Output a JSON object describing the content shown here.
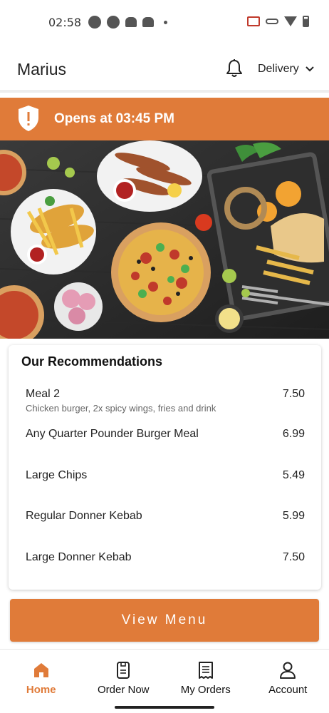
{
  "status_bar": {
    "time": "02:58"
  },
  "header": {
    "title": "Marius",
    "delivery_label": "Delivery"
  },
  "banner": {
    "text": "Opens at 03:45 PM",
    "icon_glyph": "!",
    "color": "#e07b39"
  },
  "recommendations": {
    "title": "Our Recommendations",
    "items": [
      {
        "name": "Meal 2",
        "description": "Chicken burger, 2x spicy wings, fries and drink",
        "price": "7.50"
      },
      {
        "name": "Any Quarter Pounder Burger Meal",
        "price": "6.99"
      },
      {
        "name": "Large Chips",
        "price": "5.49"
      },
      {
        "name": "Regular Donner Kebab",
        "price": "5.99"
      },
      {
        "name": "Large Donner Kebab",
        "price": "7.50"
      }
    ]
  },
  "view_menu_label": "View Menu",
  "bottom_nav": [
    {
      "label": "Home",
      "icon": "home-icon",
      "active": true
    },
    {
      "label": "Order Now",
      "icon": "order-icon",
      "active": false
    },
    {
      "label": "My Orders",
      "icon": "receipt-icon",
      "active": false
    },
    {
      "label": "Account",
      "icon": "person-icon",
      "active": false
    }
  ],
  "colors": {
    "accent": "#e07b39",
    "active_nav": "#e07b39"
  }
}
